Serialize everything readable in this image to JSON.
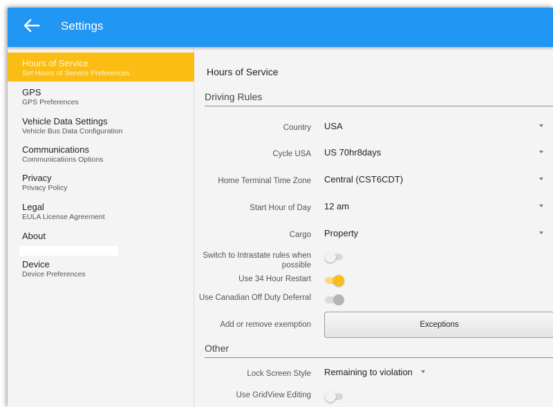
{
  "appbar": {
    "title": "Settings",
    "back_icon": "back-arrow-icon",
    "color": "#2196f3"
  },
  "accent_color": "#fbbd13",
  "sidebar": {
    "items": [
      {
        "title": "Hours of Service",
        "subtitle": "Set Hours of Service Preferences",
        "active": true
      },
      {
        "title": "GPS",
        "subtitle": "GPS Preferences"
      },
      {
        "title": "Vehicle Data Settings",
        "subtitle": "Vehicle Bus Data Configuration"
      },
      {
        "title": "Communications",
        "subtitle": "Communications Options"
      },
      {
        "title": "Privacy",
        "subtitle": "Privacy Policy"
      },
      {
        "title": "Legal",
        "subtitle": "EULA License Agreement"
      },
      {
        "title": "About",
        "subtitle": ""
      },
      {
        "title": "Device",
        "subtitle": "Device Preferences"
      }
    ]
  },
  "main": {
    "title": "Hours of Service",
    "driving_rules": {
      "header": "Driving Rules",
      "country": {
        "label": "Country",
        "value": "USA"
      },
      "cycle": {
        "label": "Cycle USA",
        "value": "US 70hr8days"
      },
      "time_zone": {
        "label": "Home Terminal Time Zone",
        "value": "Central (CST6CDT)"
      },
      "start_hour": {
        "label": "Start Hour of Day",
        "value": "12 am"
      },
      "cargo": {
        "label": "Cargo",
        "value": "Property"
      },
      "intrastate": {
        "label": "Switch to Intrastate rules when possible",
        "state": "off"
      },
      "restart34": {
        "label": "Use 34 Hour Restart",
        "state": "on"
      },
      "canadian_deferral": {
        "label": "Use Canadian Off Duty Deferral",
        "state": "disabled"
      },
      "exemption": {
        "label": "Add or remove exemption",
        "button": "Exceptions"
      }
    },
    "other": {
      "header": "Other",
      "lock_screen": {
        "label": "Lock Screen Style",
        "value": "Remaining to violation"
      },
      "gridview": {
        "label": "Use GridView Editing",
        "state": "off"
      }
    }
  }
}
